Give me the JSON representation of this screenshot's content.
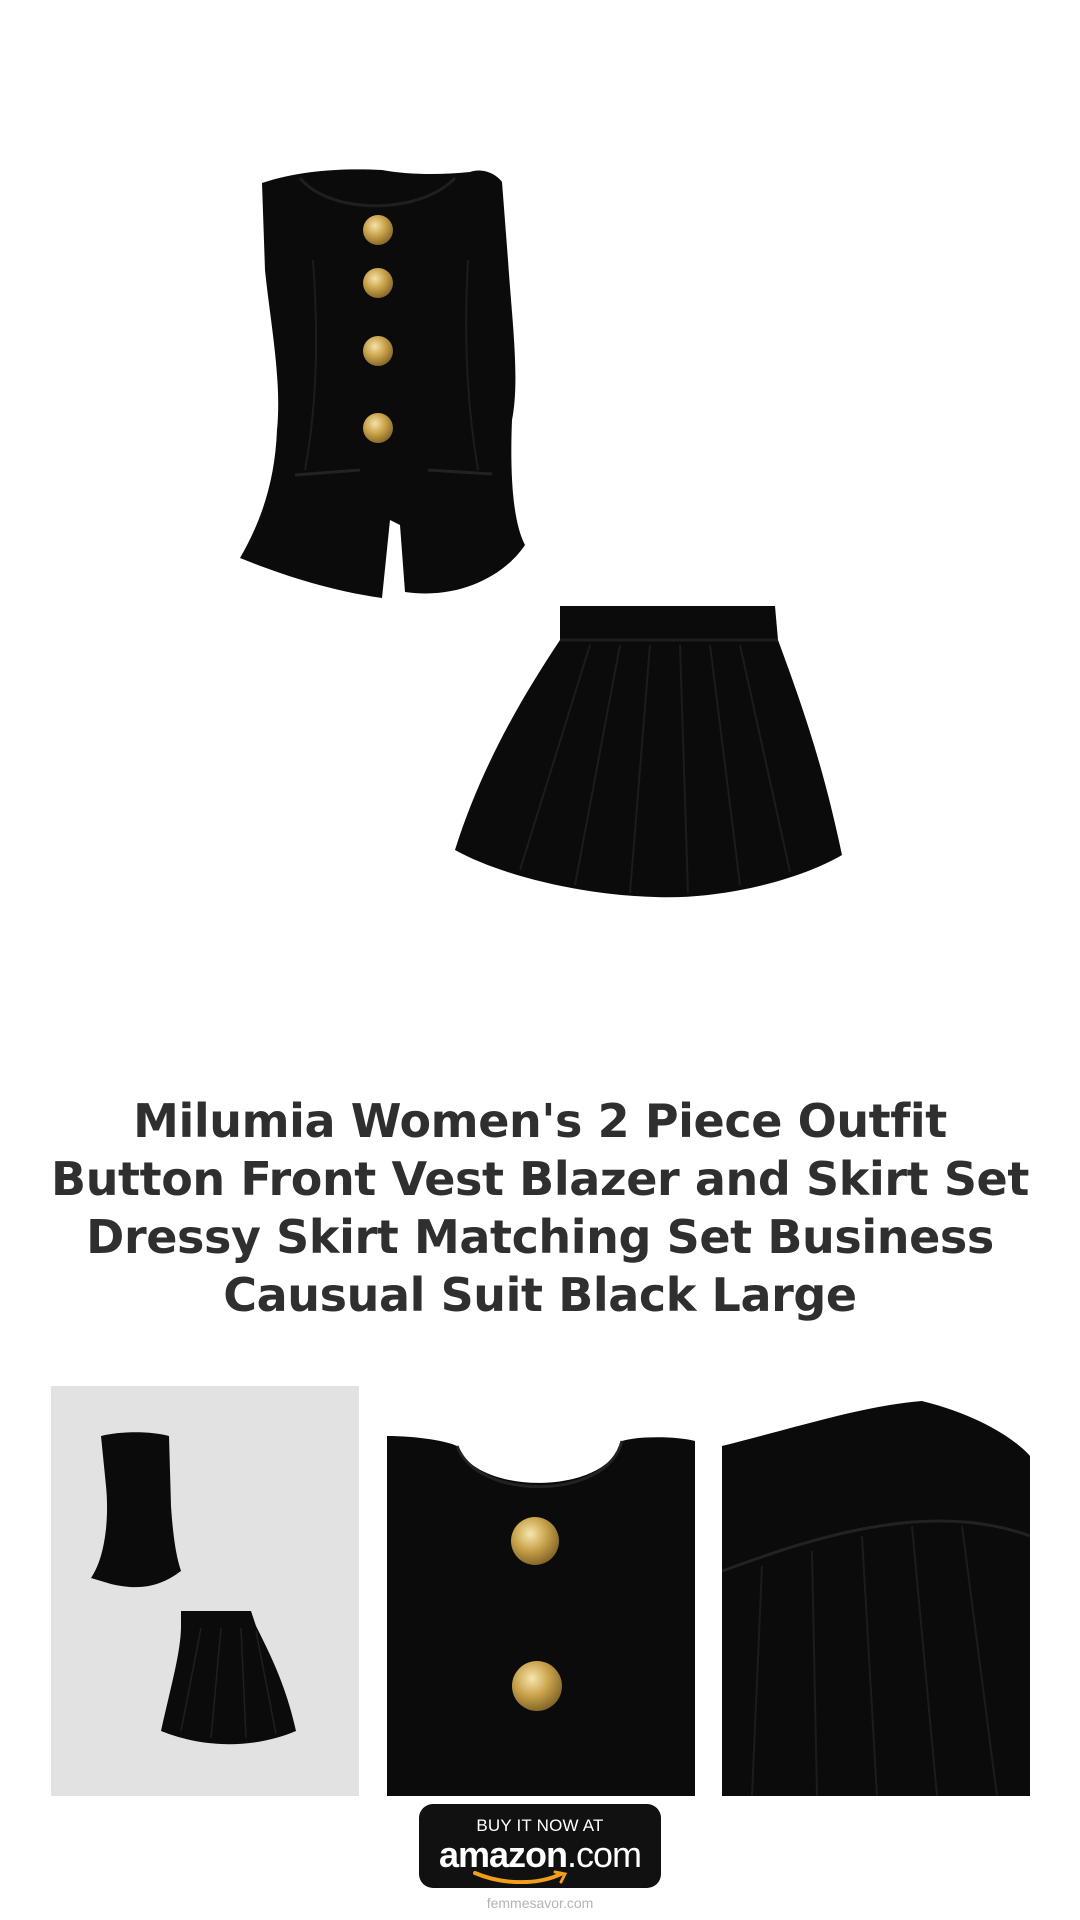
{
  "product": {
    "title": "Milumia Women's 2 Piece Outfit Button Front Vest Blazer and Skirt Set Dressy Skirt Matching Set Business Causual Suit Black Large"
  },
  "images": {
    "hero": "vest-and-skirt-product-photo",
    "thumbnails": [
      "outfit-on-gray",
      "button-closeup",
      "skirt-pleat-closeup"
    ]
  },
  "cta": {
    "top_text": "BUY IT NOW AT",
    "brand_main": "amazon",
    "brand_suffix": ".com"
  },
  "footer": {
    "site": "femmesavor.com"
  },
  "colors": {
    "garment": "#0b0b0b",
    "button_gold": "#c9a24a",
    "title": "#2f2f2f",
    "thumb_bg": "#e2e2e2",
    "amazon_orange": "#f19e1b"
  }
}
